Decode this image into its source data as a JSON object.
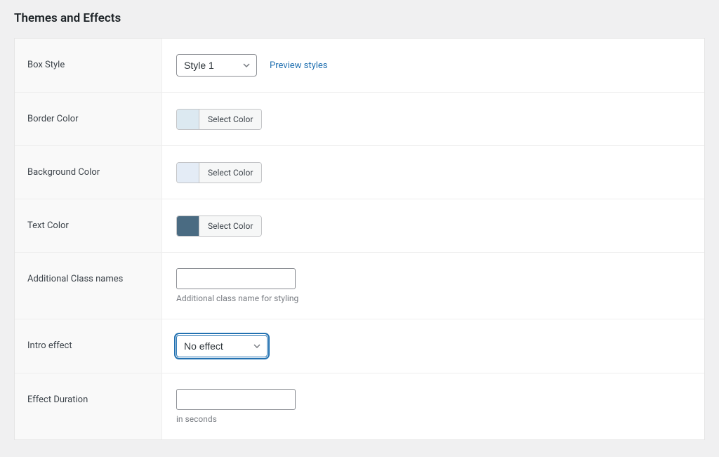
{
  "section_title": "Themes and Effects",
  "rows": {
    "box_style": {
      "label": "Box Style",
      "selected": "Style 1",
      "preview_link": "Preview styles"
    },
    "border_color": {
      "label": "Border Color",
      "swatch": "#dce9f1",
      "button": "Select Color"
    },
    "background_color": {
      "label": "Background Color",
      "swatch": "#e4ecf6",
      "button": "Select Color"
    },
    "text_color": {
      "label": "Text Color",
      "swatch": "#4a6b82",
      "button": "Select Color"
    },
    "additional_class": {
      "label": "Additional Class names",
      "value": "",
      "hint": "Additional class name for styling"
    },
    "intro_effect": {
      "label": "Intro effect",
      "selected": "No effect"
    },
    "effect_duration": {
      "label": "Effect Duration",
      "value": "",
      "hint": "in seconds"
    }
  }
}
